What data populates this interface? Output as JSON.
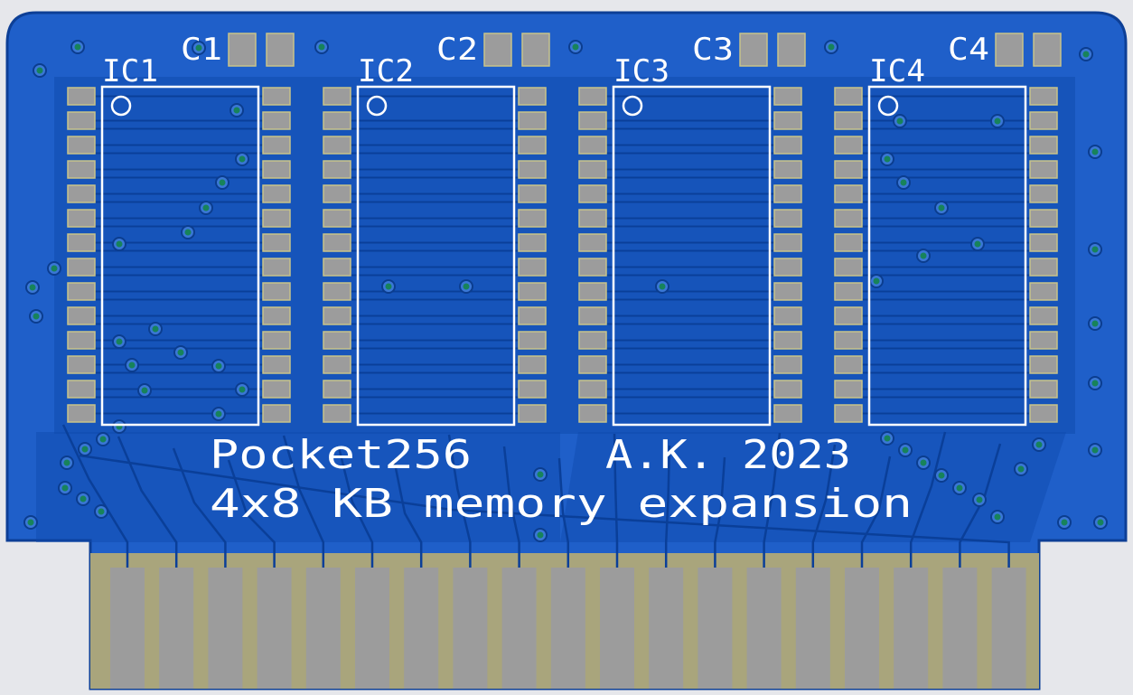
{
  "board": {
    "title": "Pocket256",
    "author": "A.K. 2023",
    "subtitle": "4x8 KB memory expansion"
  },
  "chips": [
    {
      "ref": "IC1",
      "cap": "C1"
    },
    {
      "ref": "IC2",
      "cap": "C2"
    },
    {
      "ref": "IC3",
      "cap": "C3"
    },
    {
      "ref": "IC4",
      "cap": "C4"
    }
  ],
  "edge_connector": {
    "contacts": 19
  },
  "colors": {
    "background": "#e6e7eb",
    "board_fill": "#1f5fc9",
    "board_edge": "#0d3f96",
    "trace": "#0a3f99",
    "pad": "#9c9c9c",
    "pad_edge": "#c8c38a",
    "via": "#17835a",
    "silkscreen": "#ffffff",
    "gold_finger": "#a9a57c"
  }
}
